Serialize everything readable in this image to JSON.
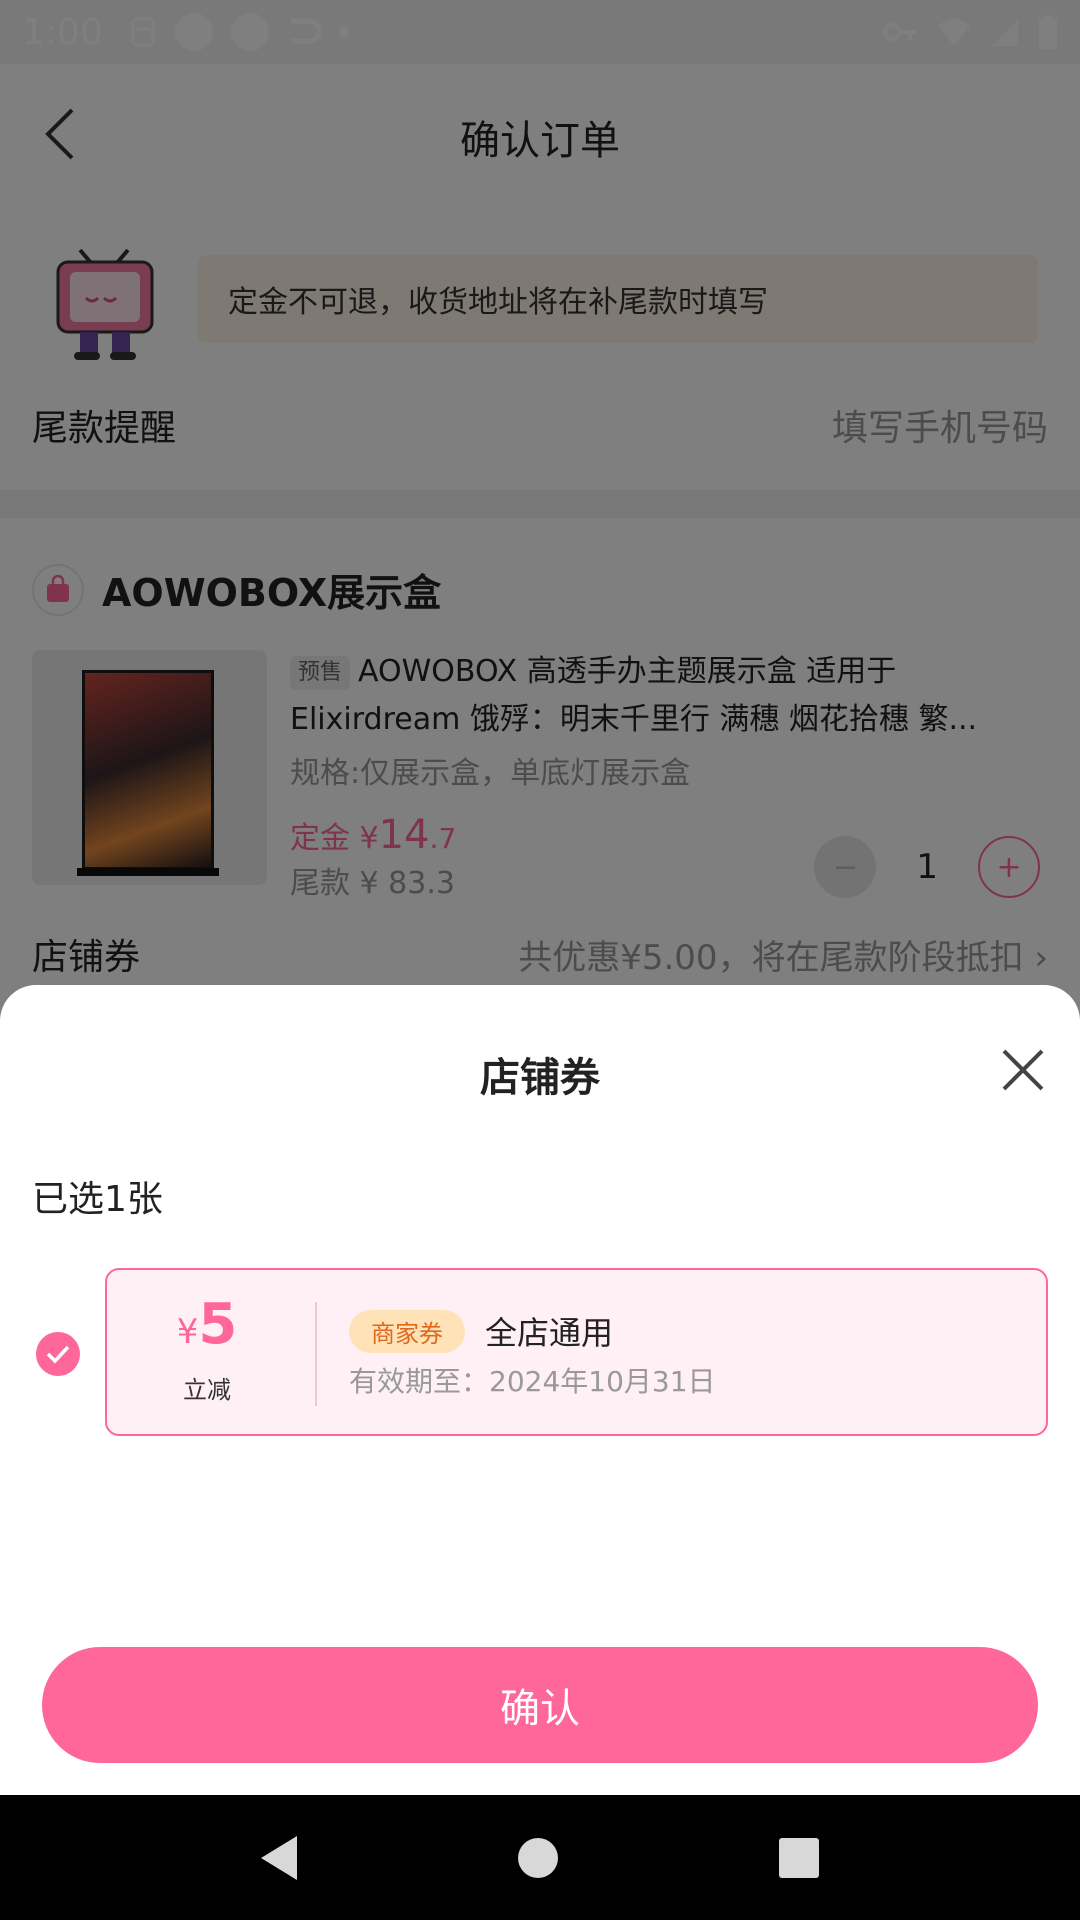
{
  "status_bar": {
    "time": "1:00"
  },
  "header": {
    "title": "确认订单"
  },
  "notice": {
    "text": "定金不可退，收货地址将在补尾款时填写"
  },
  "reminder": {
    "label": "尾款提醒",
    "placeholder": "填写手机号码"
  },
  "shop": {
    "name": "AOWOBOX展示盒",
    "product": {
      "tag": "预售",
      "title": "AOWOBOX 高透手办主题展示盒 适用于 Elixirdream 饿殍：明末千里行 满穗 烟花拾穗 繁...",
      "spec": "规格:仅展示盒，单底灯展示盒",
      "deposit_label": "定金",
      "deposit_symbol": "¥",
      "deposit_int": "14",
      "deposit_dec": ".7",
      "balance": "尾款 ¥ 83.3",
      "quantity": "1",
      "minus": "−",
      "plus": "+"
    },
    "coupon_row": {
      "label": "店铺券",
      "value": "共优惠¥5.00，将在尾款阶段抵扣"
    }
  },
  "sheet": {
    "title": "店铺券",
    "selected_count": "已选1张",
    "coupon": {
      "symbol": "¥",
      "amount": "5",
      "reduce_label": "立减",
      "tag": "商家券",
      "scope": "全店通用",
      "expiry": "有效期至：2024年10月31日",
      "selected": true
    },
    "confirm_label": "确认"
  },
  "colors": {
    "accent": "#ff6699",
    "tag_bg": "#ffe2b8",
    "tag_text": "#e0681a"
  }
}
